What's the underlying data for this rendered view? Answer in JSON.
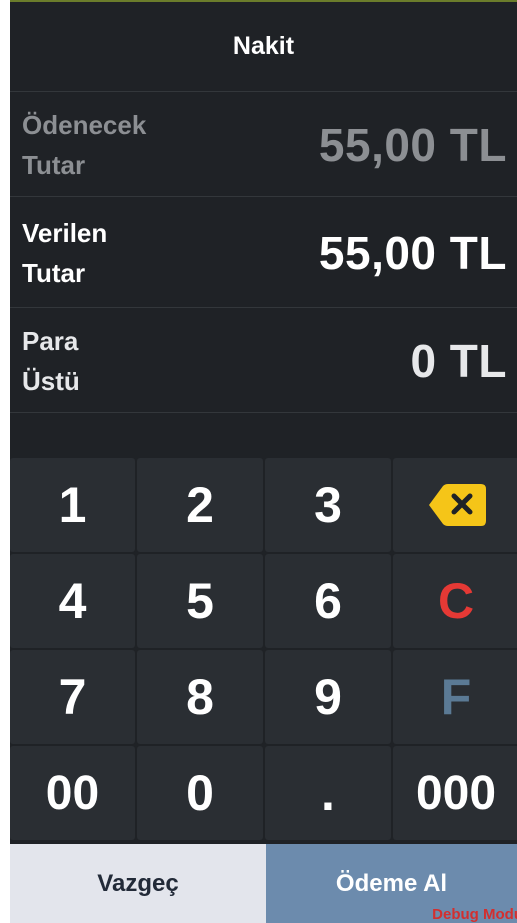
{
  "header": {
    "title": "Nakit"
  },
  "amounts": {
    "due_label_line1": "Ödenecek",
    "due_label_line2": "Tutar",
    "due_value": "55,00 TL",
    "given_label_line1": "Verilen",
    "given_label_line2": "Tutar",
    "given_value": "55,00 TL",
    "change_label_line1": "Para",
    "change_label_line2": "Üstü",
    "change_value": "0 TL"
  },
  "keypad": {
    "k1": "1",
    "k2": "2",
    "k3": "3",
    "backspace_icon": "backspace-icon",
    "k4": "4",
    "k5": "5",
    "k6": "6",
    "clear": "C",
    "k7": "7",
    "k8": "8",
    "k9": "9",
    "func": "F",
    "k00": "00",
    "k0": "0",
    "dot": ".",
    "k000": "000"
  },
  "footer": {
    "cancel_label": "Vazgeç",
    "pay_label": "Ödeme Al",
    "debug_text": "Debug Modu"
  },
  "colors": {
    "background": "#1f2226",
    "key": "#2a2e33",
    "clear": "#e53935",
    "func": "#5b7a95",
    "backspace": "#f5c518",
    "cancel_bg": "#e3e5ec",
    "pay_bg": "#6c8bad",
    "muted_text": "#8c8f93"
  }
}
